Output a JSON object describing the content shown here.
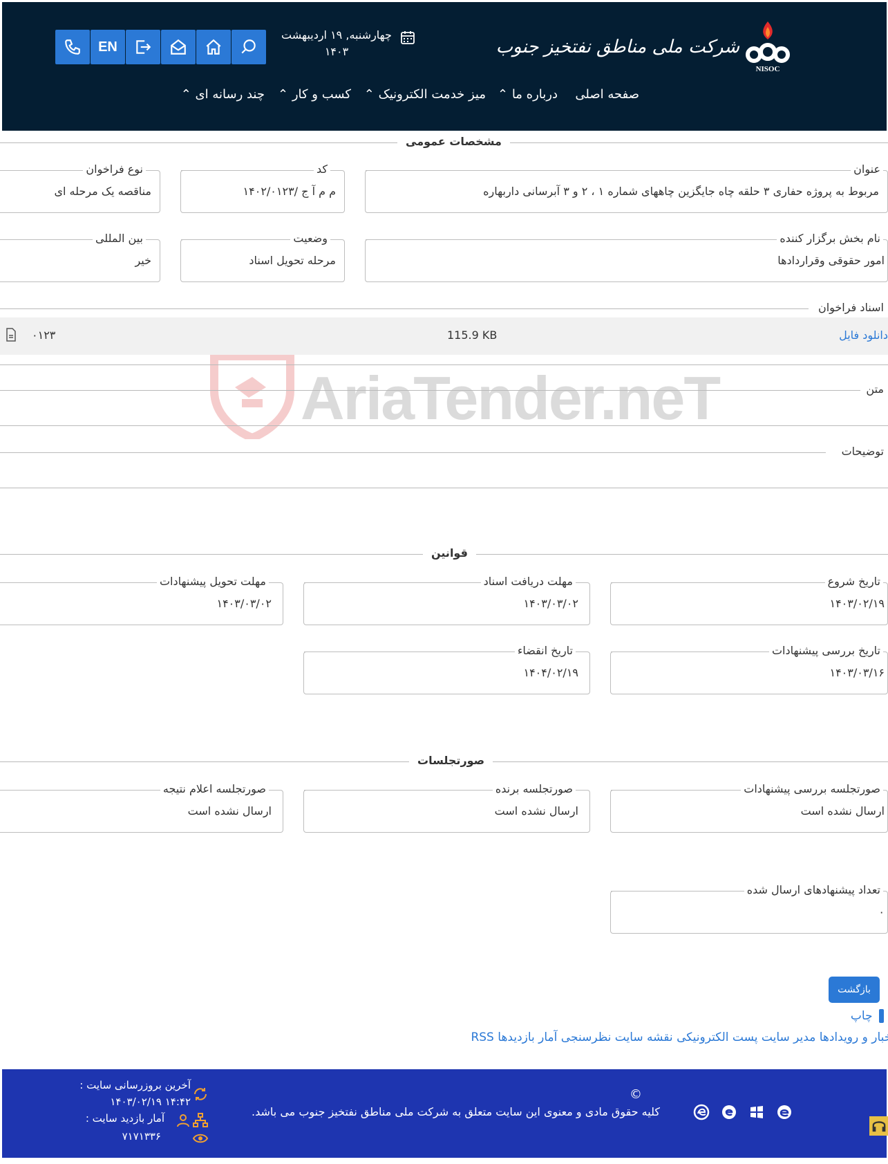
{
  "header": {
    "org_name": "شرکت ملی مناطق نفتخیز جنوب",
    "logo_abbr": "NISOC",
    "date_line1": "چهارشنبه, ۱۹ اردیبهشت",
    "date_line2": "۱۴۰۳",
    "lang_label": "EN",
    "nav": [
      {
        "label": "صفحه اصلی"
      },
      {
        "label": "درباره ما"
      },
      {
        "label": "میز خدمت الکترونیک"
      },
      {
        "label": "کسب و کار"
      },
      {
        "label": "چند رسانه ای"
      }
    ]
  },
  "general": {
    "title": "مشخصات عمومی",
    "fields": {
      "subject_label": "عنوان",
      "subject_value": "مربوط به پروژه حفاری ۳ حلقه چاه جایگزین چاههای شماره ۱ ، ۲ و ۳ آبرسانی داربهاره",
      "code_label": "کد",
      "code_value": "م م آ ج /۱۴۰۲/۰۱۲۳",
      "type_label": "نوع فراخوان",
      "type_value": "مناقصه یک مرحله ای",
      "dept_label": "نام بخش برگزار کننده",
      "dept_value": "امور حقوقی وقراردادها",
      "status_label": "وضعیت",
      "status_value": "مرحله تحویل اسناد",
      "intl_label": "بین المللی",
      "intl_value": "خیر"
    },
    "docs_label": "اسناد فراخوان",
    "doc_row": {
      "download": "دانلود فایل",
      "size": "115.9 KB",
      "name": "۰۱۲۳"
    },
    "text_label": "متن",
    "desc_label": "توضیحات"
  },
  "rules": {
    "title": "قوانین",
    "start_label": "تاریخ شروع",
    "start_value": "۱۴۰۳/۰۲/۱۹",
    "doc_deadline_label": "مهلت دریافت اسناد",
    "doc_deadline_value": "۱۴۰۳/۰۳/۰۲",
    "offer_deadline_label": "مهلت تحویل پیشنهادات",
    "offer_deadline_value": "۱۴۰۳/۰۳/۰۲",
    "review_label": "تاریخ بررسی پیشنهادات",
    "review_value": "۱۴۰۳/۰۳/۱۶",
    "expire_label": "تاریخ انقضاء",
    "expire_value": "۱۴۰۴/۰۲/۱۹"
  },
  "minutes": {
    "title": "صورتجلسات",
    "review_label": "صورتجلسه بررسی پیشنهادات",
    "review_value": "ارسال نشده است",
    "winner_label": "صورتجلسه برنده",
    "winner_value": "ارسال نشده است",
    "result_label": "صورتجلسه اعلام نتیجه",
    "result_value": "ارسال نشده است",
    "count_label": "تعداد پیشنهادهای ارسال شده",
    "count_value": "۰"
  },
  "actions": {
    "back_label": "بازگشت",
    "print_label": "چاپ"
  },
  "footer_links": [
    "اخبار و رویدادها",
    "مدیر سایت",
    "پست الکترونیکی",
    "نقشه سایت",
    "نظرسنجی",
    "آمار بازدیدها",
    "RSS"
  ],
  "footer": {
    "copyright_symbol": "©",
    "copyright": "کلیه حقوق مادی و معنوی این سایت متعلق به شرکت ملی مناطق نفتخیز جنوب می باشد.",
    "last_update_label": "آخرین بروزرسانی سایت :",
    "last_update_value": "۱۴:۴۲ ۱۴۰۳/۰۲/۱۹",
    "visits_label": "آمار بازدید سایت :",
    "visits_value": "۷۱۷۱۳۳۶"
  },
  "watermark": "AriaTender.neT",
  "colors": {
    "header_bg": "#041e33",
    "accent": "#2b79d6",
    "footer_bg": "#1e35b0"
  }
}
